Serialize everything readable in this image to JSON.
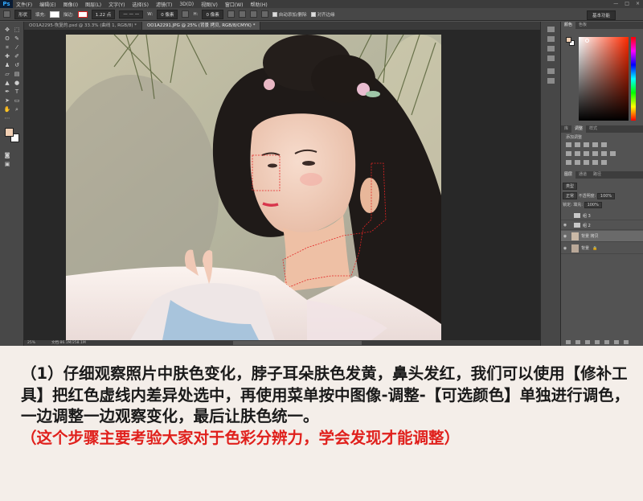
{
  "app": {
    "logo": "Ps",
    "menu": [
      "文件(F)",
      "编辑(E)",
      "图像(I)",
      "图层(L)",
      "文字(Y)",
      "选择(S)",
      "滤镜(T)",
      "3D(D)",
      "视图(V)",
      "窗口(W)",
      "帮助(H)"
    ],
    "window_controls": [
      "—",
      "□",
      "×"
    ]
  },
  "options_bar": {
    "tool_mode": "形状",
    "fill_label": "填充:",
    "stroke_label": "描边:",
    "stroke_width": "1.22 点",
    "width_label": "W:",
    "width_value": "0 像素",
    "height_label": "H:",
    "height_value": "0 像素",
    "auto_add_delete": "自动添加/删除",
    "align_edges": "对齐边缘",
    "workspace": "基本功能"
  },
  "tabs": [
    {
      "label": "OO1A2295-恢复的.psd @ 33.3% (曲线 1, RGB/8) *",
      "active": false
    },
    {
      "label": "OO1A2291.JPG @ 25% (背景 拷贝, RGB/8/CMYK) *",
      "active": true
    }
  ],
  "status": {
    "zoom": "25%",
    "doc": "文档:86.1M/258.1M"
  },
  "panels": {
    "color_tabs": [
      "颜色",
      "色板"
    ],
    "adj_tabs": [
      "库",
      "调整",
      "样式"
    ],
    "adj_label": "添加调整",
    "layers_tabs": [
      "图层",
      "通道",
      "路径"
    ],
    "kind_label": "类型",
    "blend_mode": "正常",
    "opacity_label": "不透明度:",
    "opacity_value": "100%",
    "lock_label": "锁定:",
    "fill_label": "填充:",
    "fill_value": "100%",
    "layers": [
      {
        "name": "组 3",
        "type": "group",
        "visible": false
      },
      {
        "name": "组 2",
        "type": "group",
        "visible": true
      },
      {
        "name": "背景 拷贝",
        "type": "image",
        "visible": true,
        "active": true
      },
      {
        "name": "背景",
        "type": "image",
        "visible": true
      }
    ]
  },
  "colors": {
    "foreground": "#f1cfb3",
    "background": "#ffffff",
    "selection_path": "#e02020",
    "caption_text": "#1a1a1a",
    "caption_note": "#e0201c"
  },
  "caption": {
    "paragraph": "（1）仔细观察照片中肤色变化，脖子耳朵肤色发黄，鼻头发红，我们可以使用【修补工具】把红色虚线内差异处选中，再使用菜单按中图像-调整-【可选颜色】单独进行调色，一边调整一边观察变化，最后让肤色统一。",
    "note": "（这个步骤主要考验大家对于色彩分辨力，学会发现才能调整）"
  }
}
